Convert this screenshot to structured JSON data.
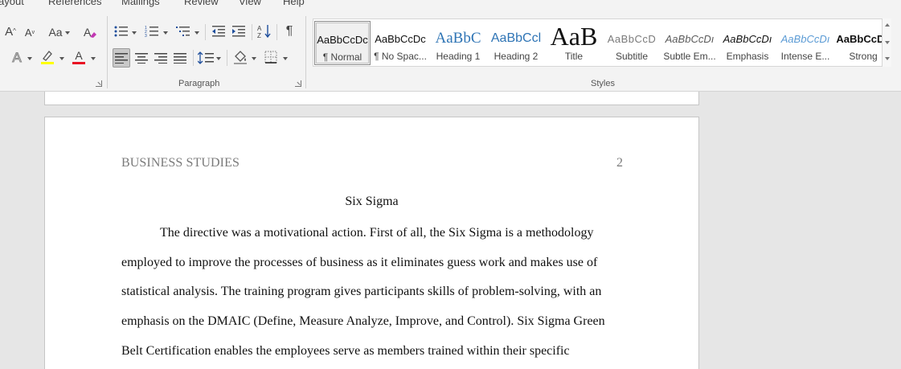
{
  "tabs": [
    "ayout",
    "References",
    "Mailings",
    "Review",
    "View",
    "Help"
  ],
  "groups": {
    "paragraph": "Paragraph",
    "styles": "Styles"
  },
  "icons": {
    "grow_font": "A",
    "shrink_font": "A",
    "change_case": "Aa",
    "text_effects": "A",
    "highlight": "ab",
    "font_color": "A",
    "sort": "A↓Z",
    "show_marks": "¶"
  },
  "colors": {
    "highlight": "#ffff00",
    "font_color": "#e81123",
    "heading": "#2e74b5",
    "intense": "#5b9bd5"
  },
  "styles": [
    {
      "sample": "AaBbCcDc",
      "name": "¶ Normal"
    },
    {
      "sample": "AaBbCcDc",
      "name": "¶ No Spac..."
    },
    {
      "sample": "AaBbC",
      "name": "Heading 1"
    },
    {
      "sample": "AaBbCcl",
      "name": "Heading 2"
    },
    {
      "sample": "AaB",
      "name": "Title"
    },
    {
      "sample": "AaBbCcD",
      "name": "Subtitle"
    },
    {
      "sample": "AaBbCcDı",
      "name": "Subtle Em..."
    },
    {
      "sample": "AaBbCcDı",
      "name": "Emphasis"
    },
    {
      "sample": "AaBbCcDı",
      "name": "Intense E..."
    },
    {
      "sample": "AaBbCcDc",
      "name": "Strong"
    }
  ],
  "document": {
    "header_left": "BUSINESS STUDIES",
    "page_number": "2",
    "title": "Six Sigma",
    "lines": [
      "The directive was a motivational action. First of all, the Six Sigma is a methodology",
      "employed to improve the processes of business as it eliminates guess work and makes use of",
      "statistical analysis. The training program gives participants skills of problem-solving, with an",
      "emphasis on the DMAIC (Define, Measure Analyze, Improve, and Control). Six Sigma Green",
      "Belt Certification enables the employees serve as members trained within their specific"
    ]
  }
}
